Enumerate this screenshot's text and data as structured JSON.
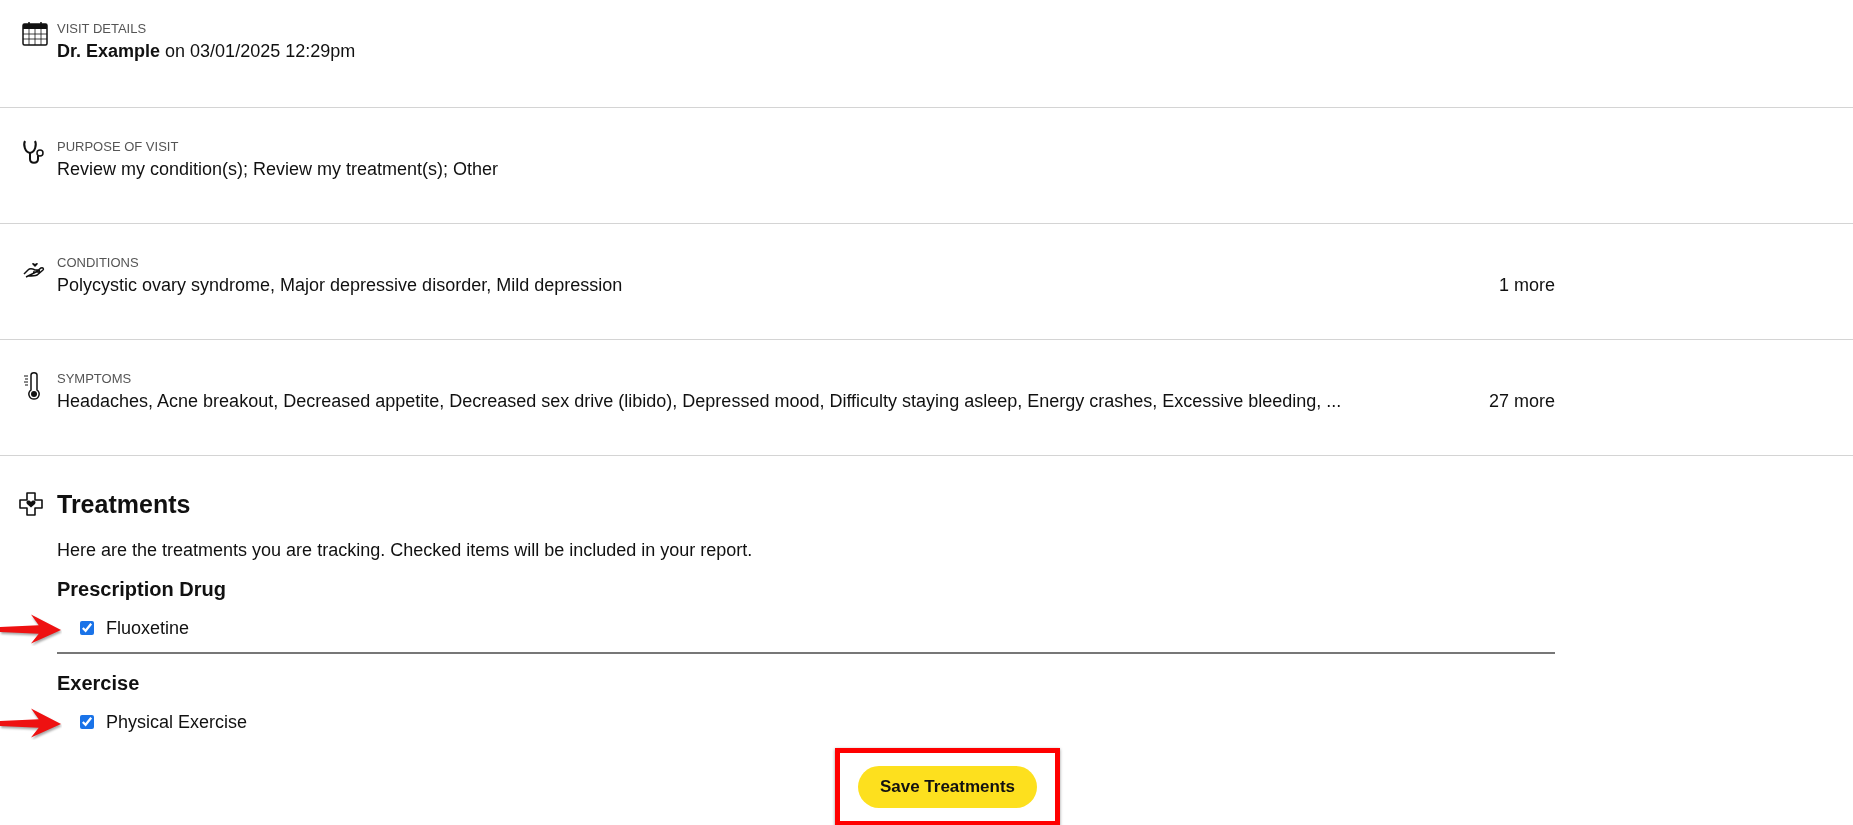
{
  "sections": [
    {
      "kind": "calendar",
      "label": "VISIT DETAILS",
      "value": "**Dr. Example** on 03/01/2025 12:29pm"
    },
    {
      "kind": "stethoscope",
      "label": "PURPOSE OF VISIT",
      "value": "Review my condition(s); Review my treatment(s); Other"
    },
    {
      "kind": "hand-heart",
      "label": "CONDITIONS",
      "value": "Polycystic ovary syndrome, Major depressive disorder, Mild depression",
      "more": "1 more"
    },
    {
      "kind": "thermometer",
      "label": "SYMPTOMS",
      "value": "Headaches, Acne breakout, Decreased appetite, Decreased sex drive (libido), Depressed mood, Difficulty staying asleep, Energy crashes, Excessive bleeding, ...",
      "more": "27 more"
    }
  ],
  "treatments": {
    "title": "Treatments",
    "description": "Here are the treatments you are tracking. Checked items will be included in your report.",
    "groups": [
      {
        "name": "Prescription Drug",
        "items": [
          {
            "label": "Fluoxetine",
            "checked": true,
            "annotated": true
          }
        ]
      },
      {
        "name": "Exercise",
        "items": [
          {
            "label": "Physical Exercise",
            "checked": true,
            "annotated": true
          }
        ]
      }
    ],
    "save_button": {
      "label": "Save Treatments",
      "highlighted": true
    }
  }
}
